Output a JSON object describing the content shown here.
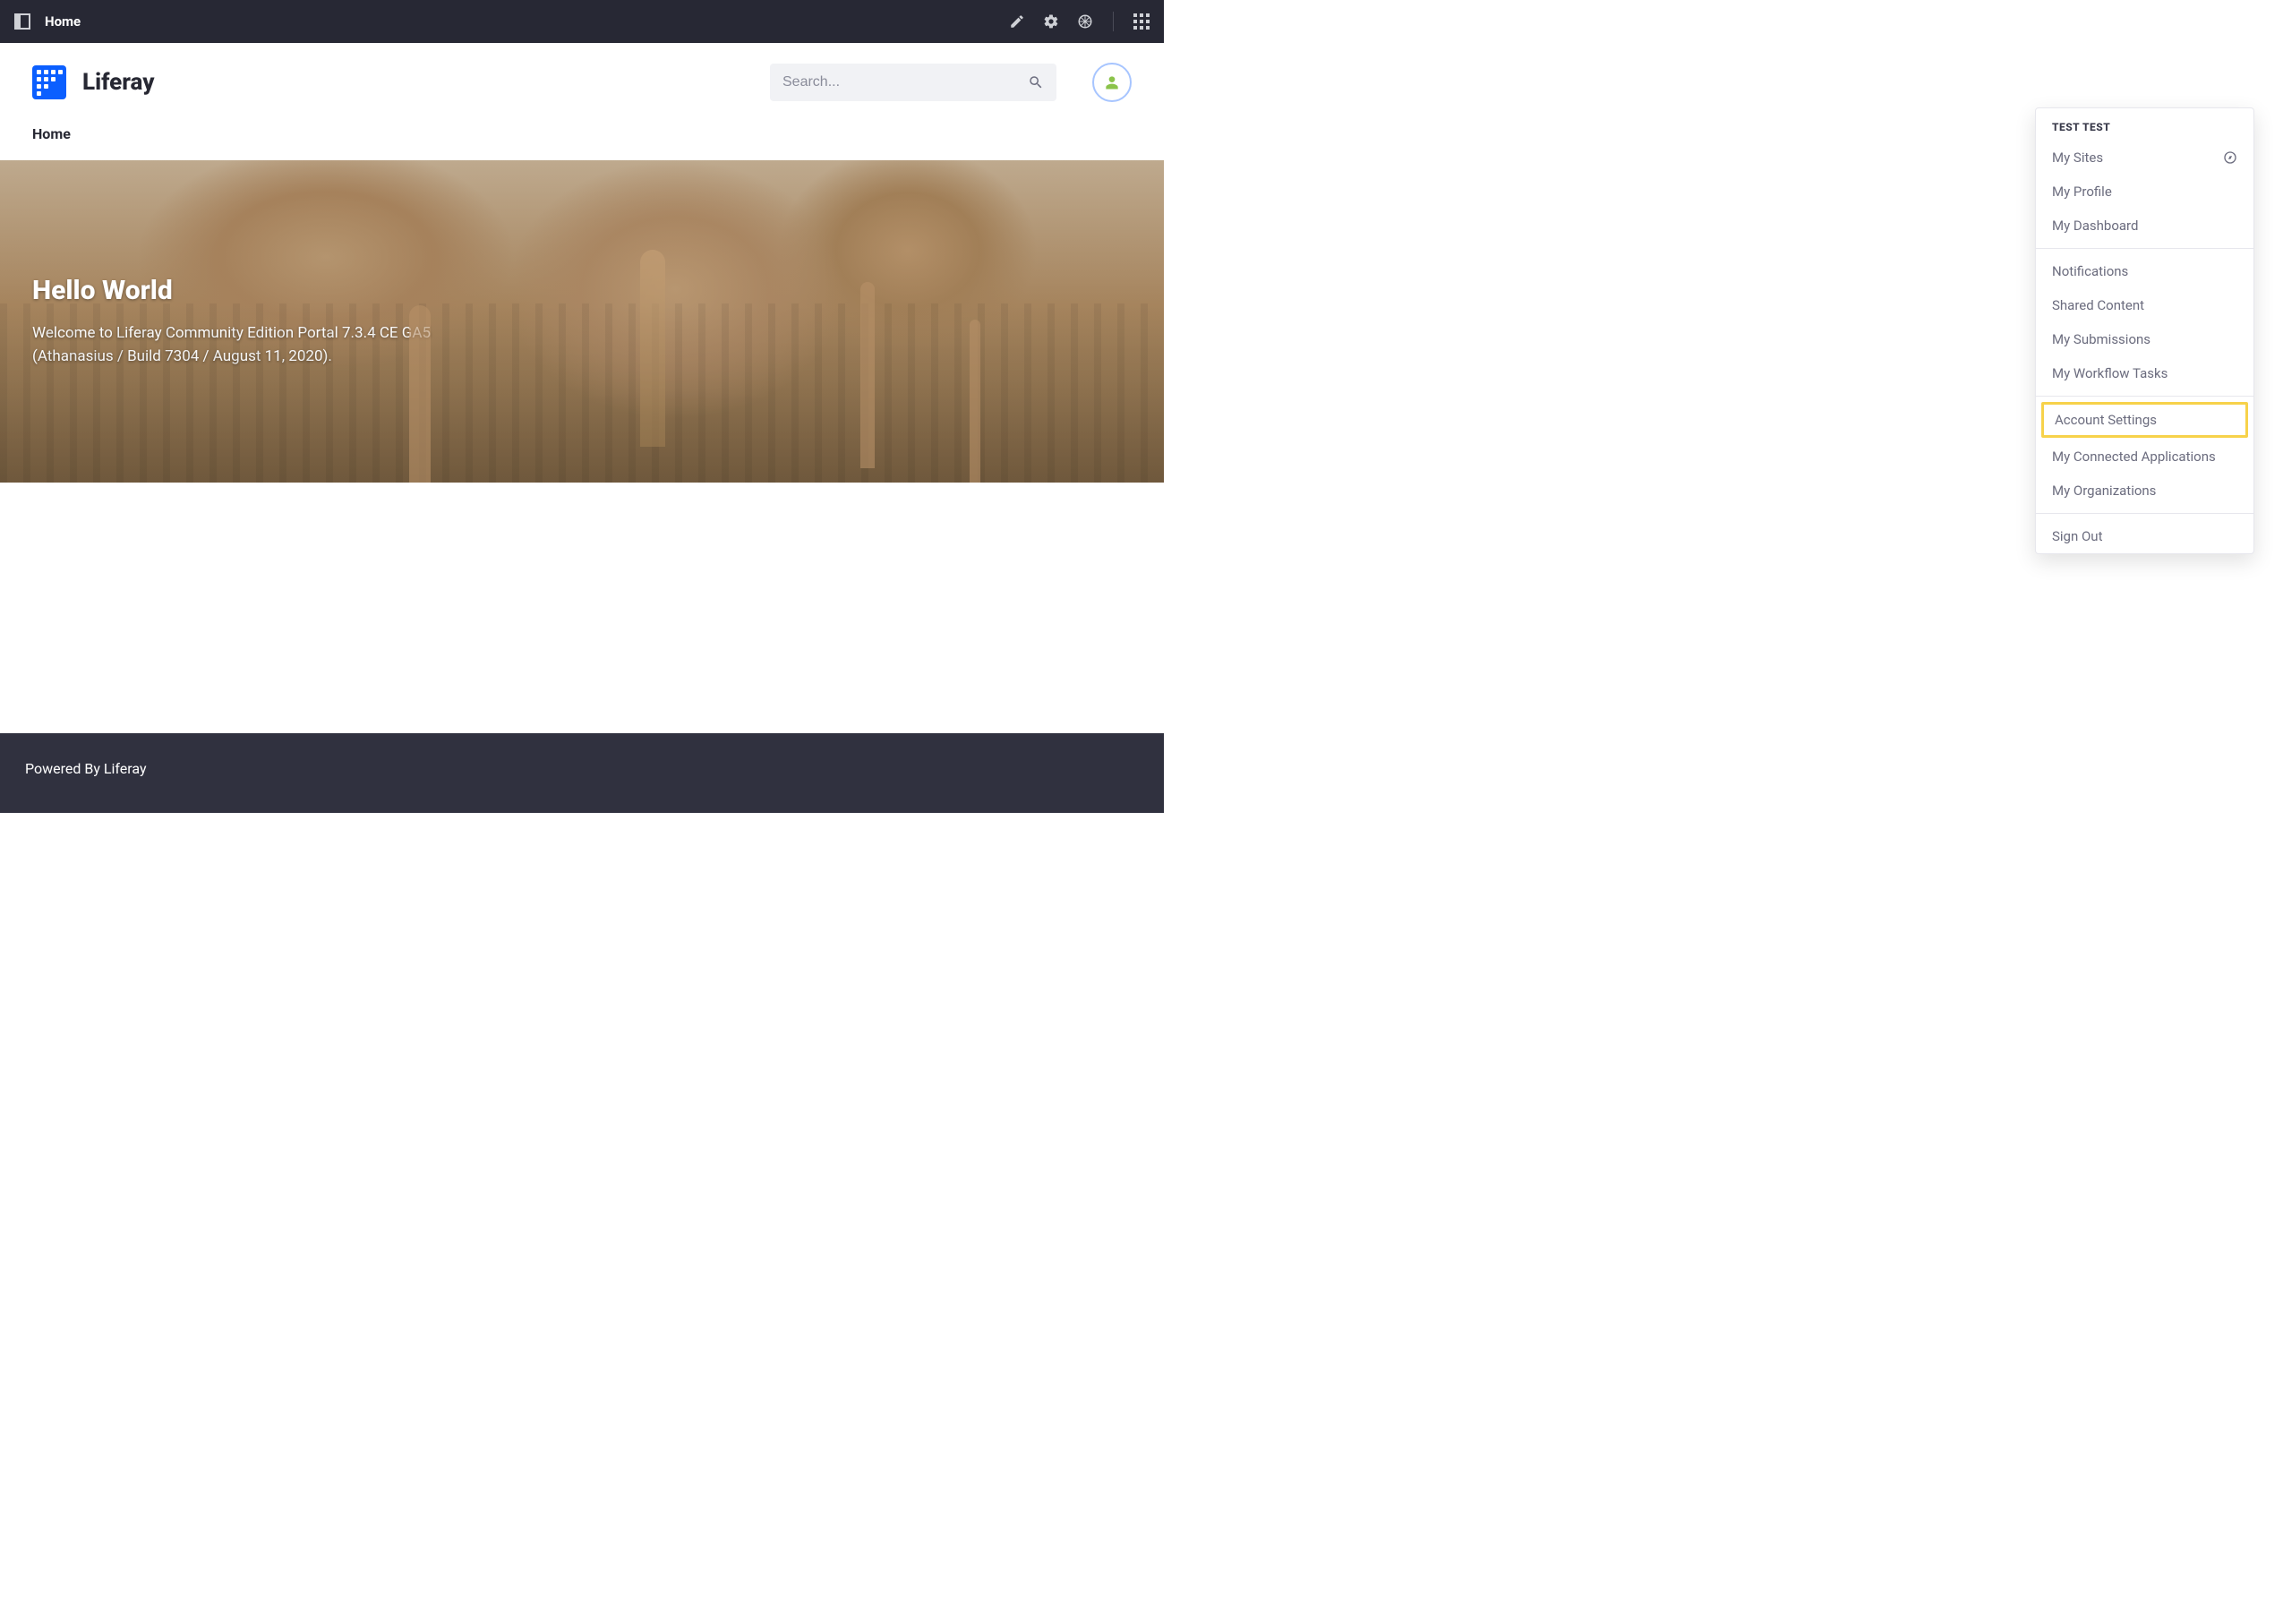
{
  "controlbar": {
    "title": "Home"
  },
  "brand": {
    "name": "Liferay"
  },
  "search": {
    "placeholder": "Search..."
  },
  "nav": {
    "home": "Home"
  },
  "hero": {
    "headline": "Hello World",
    "body": "Welcome to Liferay Community Edition Portal 7.3.4 CE GA5 (Athanasius / Build 7304 / August 11, 2020)."
  },
  "user_menu": {
    "username": "TEST TEST",
    "group1": {
      "my_sites": "My Sites",
      "my_profile": "My Profile",
      "my_dashboard": "My Dashboard"
    },
    "group2": {
      "notifications": "Notifications",
      "shared_content": "Shared Content",
      "my_submissions": "My Submissions",
      "my_workflow_tasks": "My Workflow Tasks"
    },
    "group3": {
      "account_settings": "Account Settings",
      "my_connected_applications": "My Connected Applications",
      "my_organizations": "My Organizations"
    },
    "group4": {
      "sign_out": "Sign Out"
    }
  },
  "footer": {
    "powered_prefix": "Powered By ",
    "powered_link": "Liferay"
  }
}
